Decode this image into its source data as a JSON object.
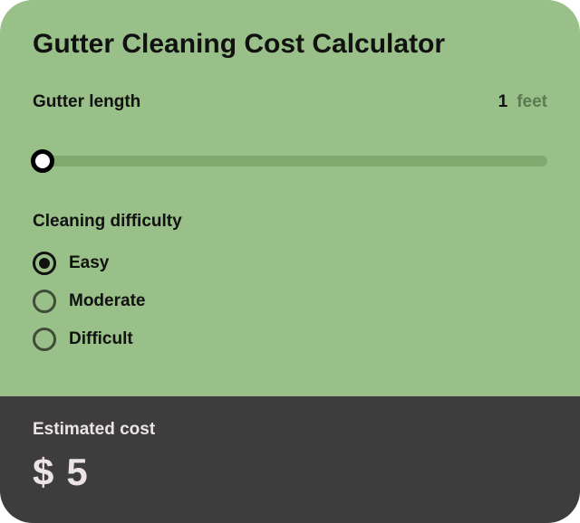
{
  "title": "Gutter Cleaning Cost Calculator",
  "length": {
    "label": "Gutter length",
    "value": "1",
    "unit": "feet"
  },
  "difficulty": {
    "label": "Cleaning difficulty",
    "options": [
      {
        "label": "Easy",
        "selected": true
      },
      {
        "label": "Moderate",
        "selected": false
      },
      {
        "label": "Difficult",
        "selected": false
      }
    ]
  },
  "result": {
    "label": "Estimated cost",
    "currency": "$",
    "amount": "5"
  }
}
